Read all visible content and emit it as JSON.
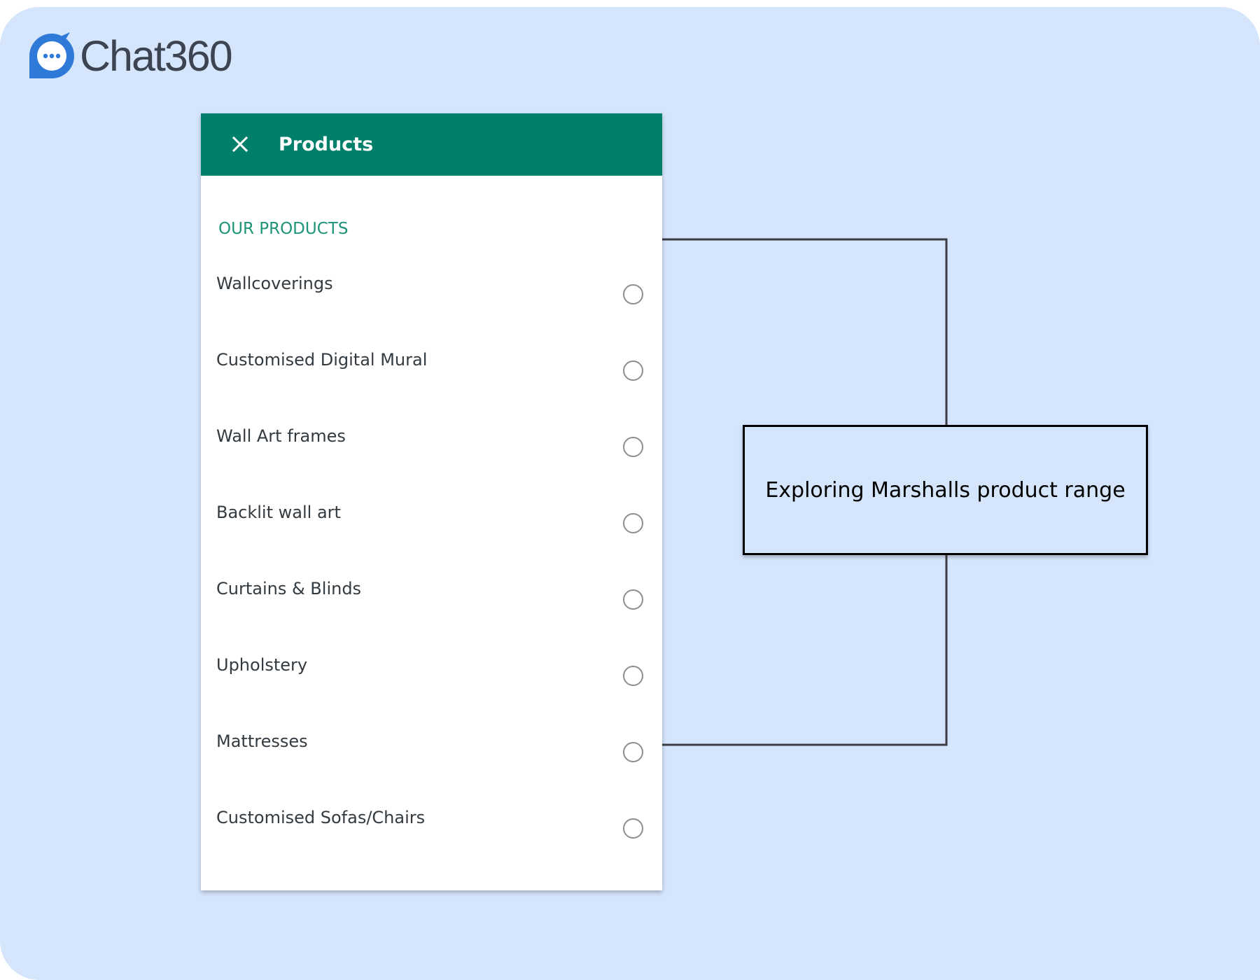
{
  "brand": {
    "name": "Chat360",
    "icon": "chat-bubble-icon",
    "mark_color": "#2f7ad8"
  },
  "panel": {
    "title": "Products",
    "close_icon": "close-icon",
    "header_color": "#00806a",
    "section_label": "OUR PRODUCTS",
    "options": [
      {
        "label": "Wallcoverings",
        "selected": false
      },
      {
        "label": "Customised Digital Mural",
        "selected": false
      },
      {
        "label": "Wall Art frames",
        "selected": false
      },
      {
        "label": "Backlit wall art",
        "selected": false
      },
      {
        "label": "Curtains & Blinds",
        "selected": false
      },
      {
        "label": "Upholstery",
        "selected": false
      },
      {
        "label": "Mattresses",
        "selected": false
      },
      {
        "label": "Customised Sofas/Chairs",
        "selected": false
      }
    ]
  },
  "annotation": {
    "text": "Exploring Marshalls product range"
  },
  "colors": {
    "background": "#d4e5fc",
    "accent": "#1e9478"
  }
}
